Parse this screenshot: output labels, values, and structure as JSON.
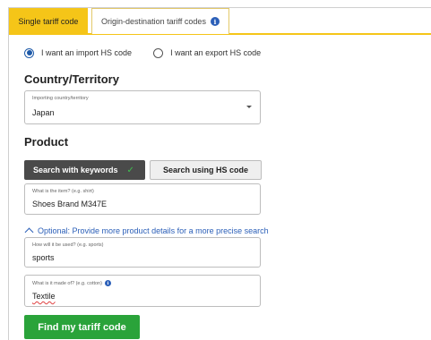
{
  "tabs": [
    {
      "label": "Single tariff code",
      "active": true
    },
    {
      "label": "Origin-destination tariff codes",
      "active": false
    }
  ],
  "hs_direction": {
    "options": [
      {
        "label": "I want an import HS code",
        "checked": true
      },
      {
        "label": "I want an export HS code",
        "checked": false
      }
    ]
  },
  "country_section": {
    "heading": "Country/Territory",
    "field_label": "Importing country/territory",
    "selected_value": "Japan"
  },
  "product_section": {
    "heading": "Product",
    "search_keywords_label": "Search with keywords",
    "search_hs_label": "Search using HS code",
    "item_field": {
      "label": "What is the item? (e.g. shirt)",
      "value": "Shoes Brand M347E"
    },
    "optional_link": "Optional: Provide more product details for a more precise search",
    "usage_field": {
      "label": "How will it be used? (e.g. sports)",
      "value": "sports"
    },
    "material_field": {
      "label": "What is it made of? (e.g. cotton)",
      "value": "Textile"
    }
  },
  "submit_label": "Find my tariff code",
  "colors": {
    "tab_accent": "#f5c518",
    "link_blue": "#2b5fb8",
    "submit_green": "#2aa33a",
    "dark_button": "#4a4a4a"
  }
}
